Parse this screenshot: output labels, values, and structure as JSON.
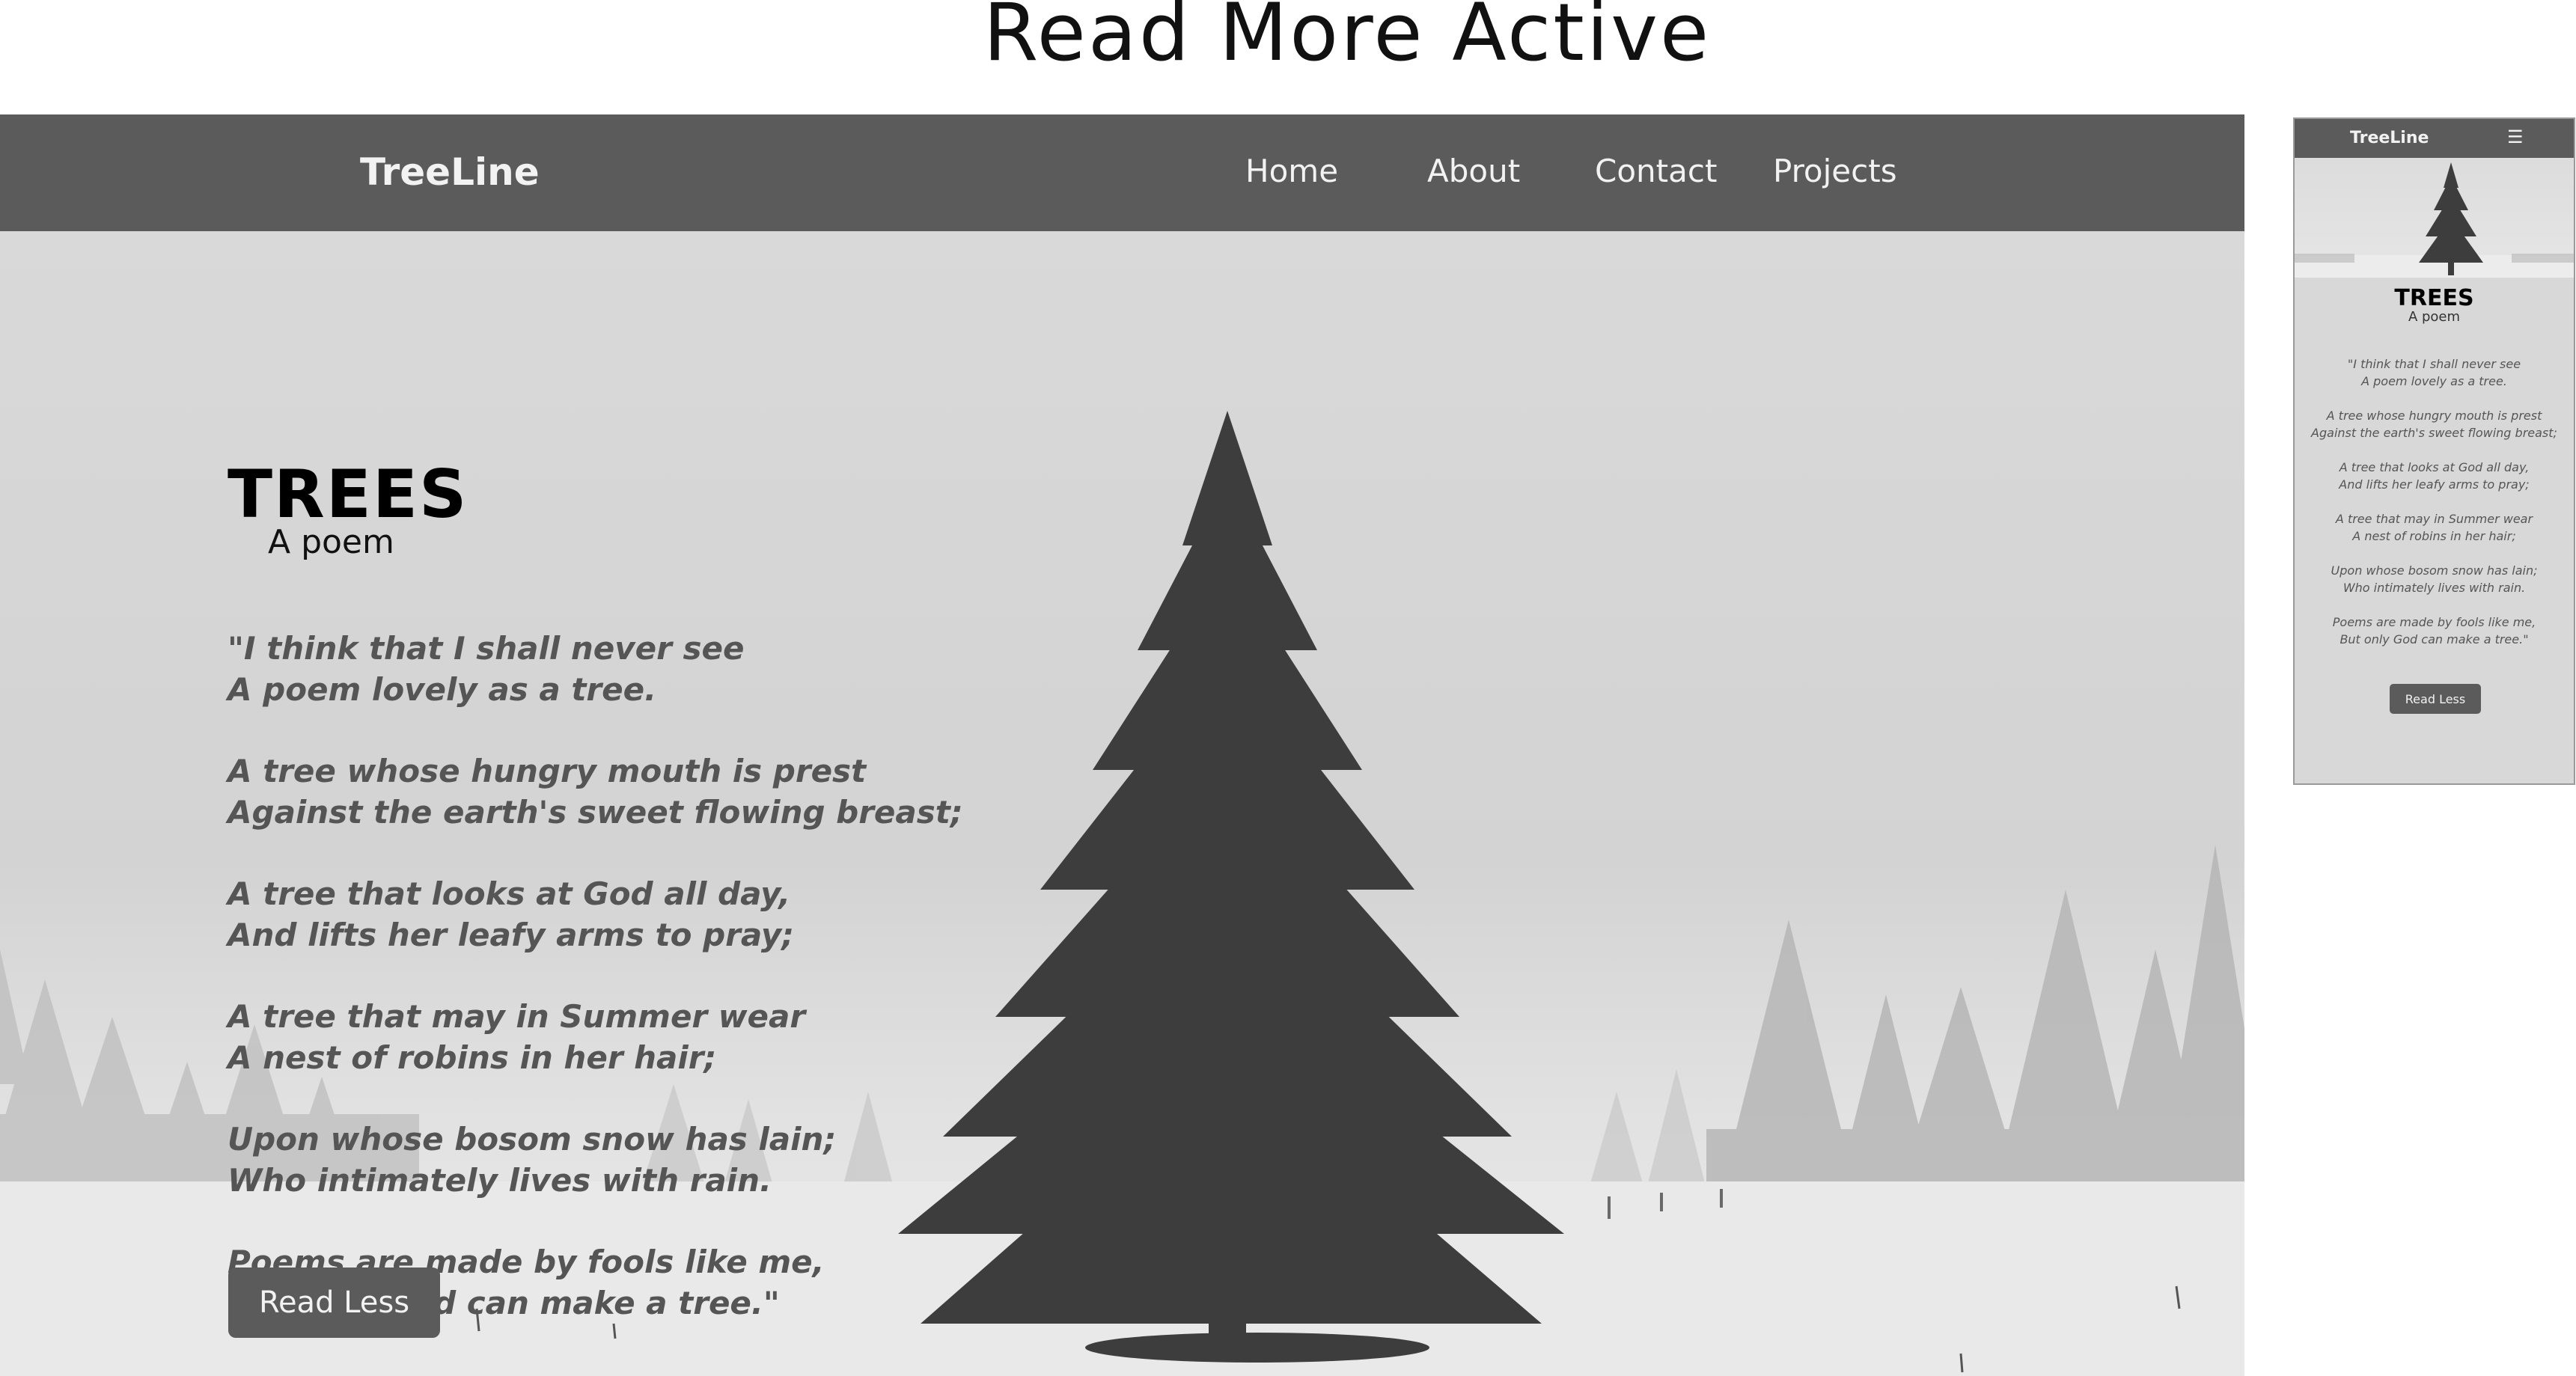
{
  "page": {
    "heading": "Read More Active"
  },
  "desktop": {
    "nav": {
      "brand": "TreeLine",
      "links": [
        "Home",
        "About",
        "Contact",
        "Projects"
      ]
    },
    "title": "TREES",
    "subtitle": "A poem",
    "poem": [
      [
        "\"I think that I shall never see",
        "A poem lovely as a tree."
      ],
      [
        "A tree whose hungry mouth is prest",
        "Against the earth's sweet flowing breast;"
      ],
      [
        "A tree that looks at God all day,",
        "And lifts her leafy arms to pray;"
      ],
      [
        "A tree that may in Summer wear",
        "A nest of robins in her hair;"
      ],
      [
        "Upon whose bosom snow has lain;",
        "Who intimately lives with rain."
      ],
      [
        "Poems are made by fools like me,",
        "But only God can make a tree.\""
      ]
    ],
    "button_label": "Read Less"
  },
  "mobile": {
    "nav": {
      "brand": "TreeLine",
      "menu_icon": "hamburger-menu-icon"
    },
    "title": "TREES",
    "subtitle": "A poem",
    "poem": [
      [
        "\"I think that I shall never see",
        "A poem lovely as a tree."
      ],
      [
        "A tree whose hungry mouth is prest",
        "Against the earth's sweet flowing breast;"
      ],
      [
        "A tree that looks at God all day,",
        "And lifts her leafy arms to pray;"
      ],
      [
        "A tree that may in Summer wear",
        "A nest of robins in her hair;"
      ],
      [
        "Upon whose bosom snow has lain;",
        "Who intimately lives with rain."
      ],
      [
        "Poems are made by fools like me,",
        "But only God can make a tree.\""
      ]
    ],
    "button_label": "Read Less"
  },
  "colors": {
    "nav_background": "#5b5b5b",
    "nav_text": "#f2f2f2",
    "poem_text": "#555555",
    "title_text": "#000000",
    "button_background": "#5b5b5b"
  }
}
